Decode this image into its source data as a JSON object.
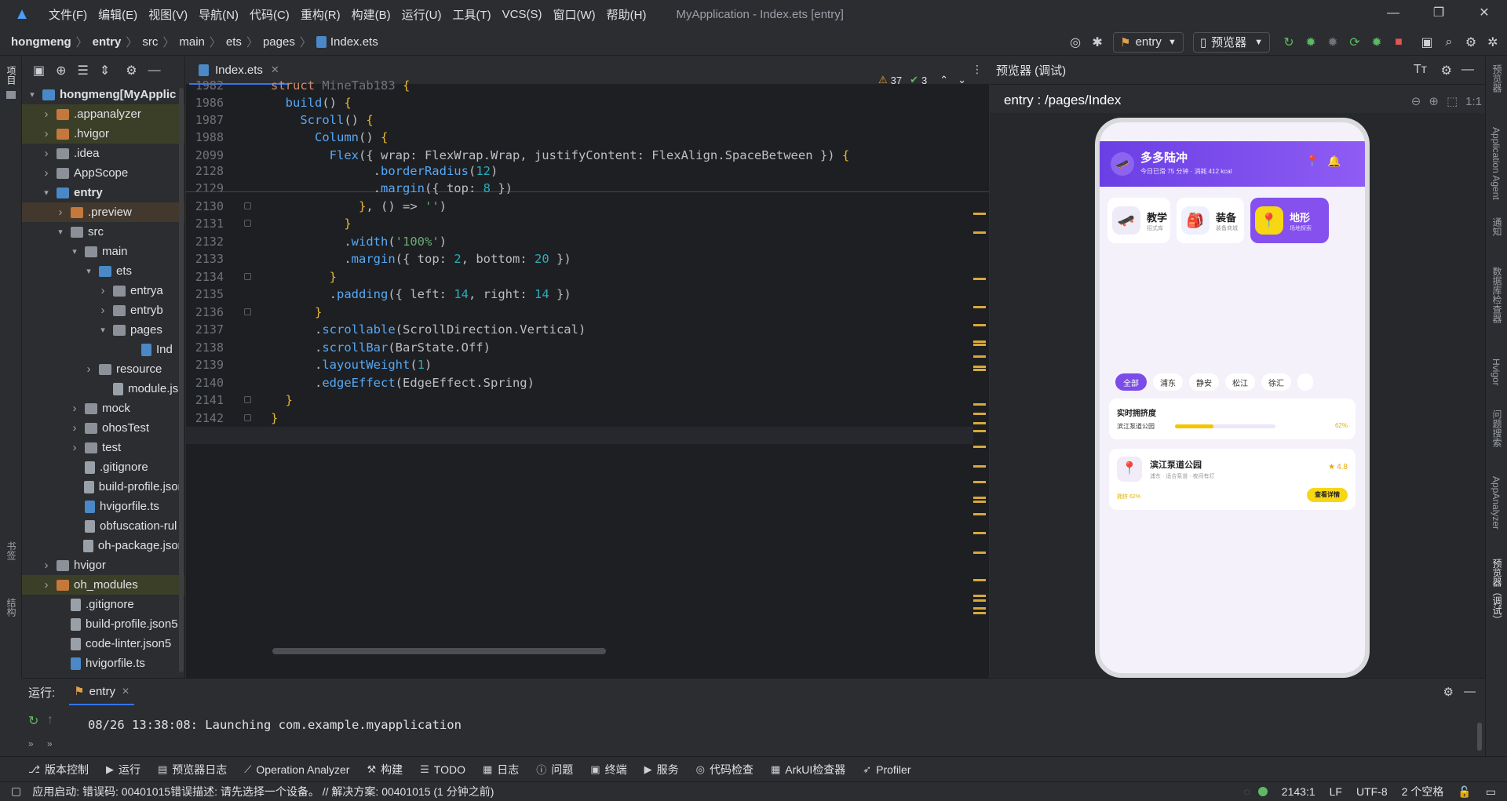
{
  "titlebar": {
    "menus": [
      "文件(F)",
      "编辑(E)",
      "视图(V)",
      "导航(N)",
      "代码(C)",
      "重构(R)",
      "构建(B)",
      "运行(U)",
      "工具(T)",
      "VCS(S)",
      "窗口(W)",
      "帮助(H)"
    ],
    "title": "MyApplication - Index.ets [entry]"
  },
  "navbar": {
    "crumbs": [
      "hongmeng",
      "entry",
      "src",
      "main",
      "ets",
      "pages",
      "Index.ets"
    ],
    "run_config": "entry",
    "device": "预览器"
  },
  "leftstrip": {
    "top_label": "项目",
    "bottom_labels": [
      "书签",
      "结构"
    ]
  },
  "rightstrip": {
    "labels": [
      "预览器",
      "Application Agent",
      "通知",
      "数据库检查器",
      "Hvigor",
      "问题搜索",
      "AppAnalyzer",
      "预览器（调试）"
    ]
  },
  "project_tree": [
    {
      "label": "hongmeng",
      "suffix": " [MyApplic",
      "indent": 0,
      "arrow": "v",
      "icon": "blue",
      "bold": true,
      "hl": ""
    },
    {
      "label": ".appanalyzer",
      "indent": 1,
      "arrow": ">",
      "icon": "orange",
      "hl": "hl"
    },
    {
      "label": ".hvigor",
      "indent": 1,
      "arrow": ">",
      "icon": "orange",
      "hl": "hl"
    },
    {
      "label": ".idea",
      "indent": 1,
      "arrow": ">",
      "icon": "folder",
      "hl": ""
    },
    {
      "label": "AppScope",
      "indent": 1,
      "arrow": ">",
      "icon": "folder",
      "hl": ""
    },
    {
      "label": "entry",
      "indent": 1,
      "arrow": "v",
      "icon": "blue",
      "bold": true,
      "hl": ""
    },
    {
      "label": ".preview",
      "indent": 2,
      "arrow": ">",
      "icon": "orange",
      "hl": "hl2"
    },
    {
      "label": "src",
      "indent": 2,
      "arrow": "v",
      "icon": "folder",
      "hl": ""
    },
    {
      "label": "main",
      "indent": 3,
      "arrow": "v",
      "icon": "folder",
      "hl": ""
    },
    {
      "label": "ets",
      "indent": 4,
      "arrow": "v",
      "icon": "blue",
      "hl": ""
    },
    {
      "label": "entrya",
      "indent": 5,
      "arrow": ">",
      "icon": "folder",
      "hl": ""
    },
    {
      "label": "entryb",
      "indent": 5,
      "arrow": ">",
      "icon": "folder",
      "hl": ""
    },
    {
      "label": "pages",
      "indent": 5,
      "arrow": "v",
      "icon": "folder",
      "hl": ""
    },
    {
      "label": "Ind",
      "indent": 7,
      "arrow": "",
      "icon": "ts",
      "hl": ""
    },
    {
      "label": "resource",
      "indent": 4,
      "arrow": ">",
      "icon": "folder",
      "hl": ""
    },
    {
      "label": "module.js",
      "indent": 5,
      "arrow": "",
      "icon": "file",
      "hl": ""
    },
    {
      "label": "mock",
      "indent": 3,
      "arrow": ">",
      "icon": "folder",
      "hl": ""
    },
    {
      "label": "ohosTest",
      "indent": 3,
      "arrow": ">",
      "icon": "folder",
      "hl": ""
    },
    {
      "label": "test",
      "indent": 3,
      "arrow": ">",
      "icon": "folder",
      "hl": ""
    },
    {
      "label": ".gitignore",
      "indent": 3,
      "arrow": "",
      "icon": "file",
      "hl": ""
    },
    {
      "label": "build-profile.json",
      "indent": 3,
      "arrow": "",
      "icon": "file",
      "hl": ""
    },
    {
      "label": "hvigorfile.ts",
      "indent": 3,
      "arrow": "",
      "icon": "ts",
      "hl": ""
    },
    {
      "label": "obfuscation-rul",
      "indent": 3,
      "arrow": "",
      "icon": "file",
      "hl": ""
    },
    {
      "label": "oh-package.json",
      "indent": 3,
      "arrow": "",
      "icon": "file",
      "hl": ""
    },
    {
      "label": "hvigor",
      "indent": 1,
      "arrow": ">",
      "icon": "folder",
      "hl": ""
    },
    {
      "label": "oh_modules",
      "indent": 1,
      "arrow": ">",
      "icon": "orange",
      "hl": "hl"
    },
    {
      "label": ".gitignore",
      "indent": 2,
      "arrow": "",
      "icon": "file",
      "hl": ""
    },
    {
      "label": "build-profile.json5",
      "indent": 2,
      "arrow": "",
      "icon": "file",
      "hl": ""
    },
    {
      "label": "code-linter.json5",
      "indent": 2,
      "arrow": "",
      "icon": "file",
      "hl": ""
    },
    {
      "label": "hvigorfile.ts",
      "indent": 2,
      "arrow": "",
      "icon": "ts",
      "hl": ""
    }
  ],
  "editor": {
    "tab_label": "Index.ets",
    "warnings": "37",
    "checks": "3",
    "sticky_lines": [
      "1982",
      "1986",
      "1987",
      "1988",
      "2099"
    ],
    "lines": [
      "2128",
      "2129",
      "2130",
      "2131",
      "2132",
      "2133",
      "2134",
      "2135",
      "2136",
      "2137",
      "2138",
      "2139",
      "2140",
      "2141",
      "2142",
      "2143"
    ]
  },
  "preview": {
    "panel_title": "预览器  (调试)",
    "path": "entry : /pages/Index",
    "zoom_label": "1:1",
    "app": {
      "title": "多多陆冲",
      "subtitle": "今日已滑 75 分钟 · 消耗 412 kcal",
      "categories": [
        {
          "title": "教学",
          "sub": "招式库",
          "icon": "🛹"
        },
        {
          "title": "装备",
          "sub": "装备商城",
          "icon": "🎒"
        },
        {
          "title": "地形",
          "sub": "场地探索",
          "icon": "📍"
        }
      ],
      "chips": [
        "全部",
        "浦东",
        "静安",
        "松江",
        "徐汇"
      ],
      "crowd": {
        "title": "实时拥挤度",
        "place": "滨江泵道公园",
        "percent": "62%",
        "level": 0.38
      },
      "spot": {
        "name": "滨江泵道公园",
        "tags": "浦东 · 适合泵道 · 夜间有灯",
        "rating": "4.8",
        "crowd": "拥挤 62%",
        "button": "查看详情"
      }
    }
  },
  "run": {
    "label": "运行:",
    "tab": "entry",
    "log": "08/26 13:38:08: Launching com.example.myapplication"
  },
  "bottombar": [
    {
      "icon": "⎇",
      "label": "版本控制"
    },
    {
      "icon": "▶",
      "label": "运行"
    },
    {
      "icon": "▤",
      "label": "预览器日志"
    },
    {
      "icon": "⟋",
      "label": "Operation Analyzer"
    },
    {
      "icon": "⚒",
      "label": "构建"
    },
    {
      "icon": "☰",
      "label": "TODO"
    },
    {
      "icon": "▦",
      "label": "日志"
    },
    {
      "icon": "ⓘ",
      "label": "问题"
    },
    {
      "icon": "▣",
      "label": "终端"
    },
    {
      "icon": "▶",
      "label": "服务"
    },
    {
      "icon": "◎",
      "label": "代码检查"
    },
    {
      "icon": "▦",
      "label": "ArkUI检查器"
    },
    {
      "icon": "➶",
      "label": "Profiler"
    }
  ],
  "status": {
    "message": "应用启动: 错误码: 00401015错误描述: 请先选择一个设备。 // 解决方案: 00401015 (1 分钟之前)",
    "position": "2143:1",
    "line_sep": "LF",
    "encoding": "UTF-8",
    "indent": "2 个空格"
  }
}
